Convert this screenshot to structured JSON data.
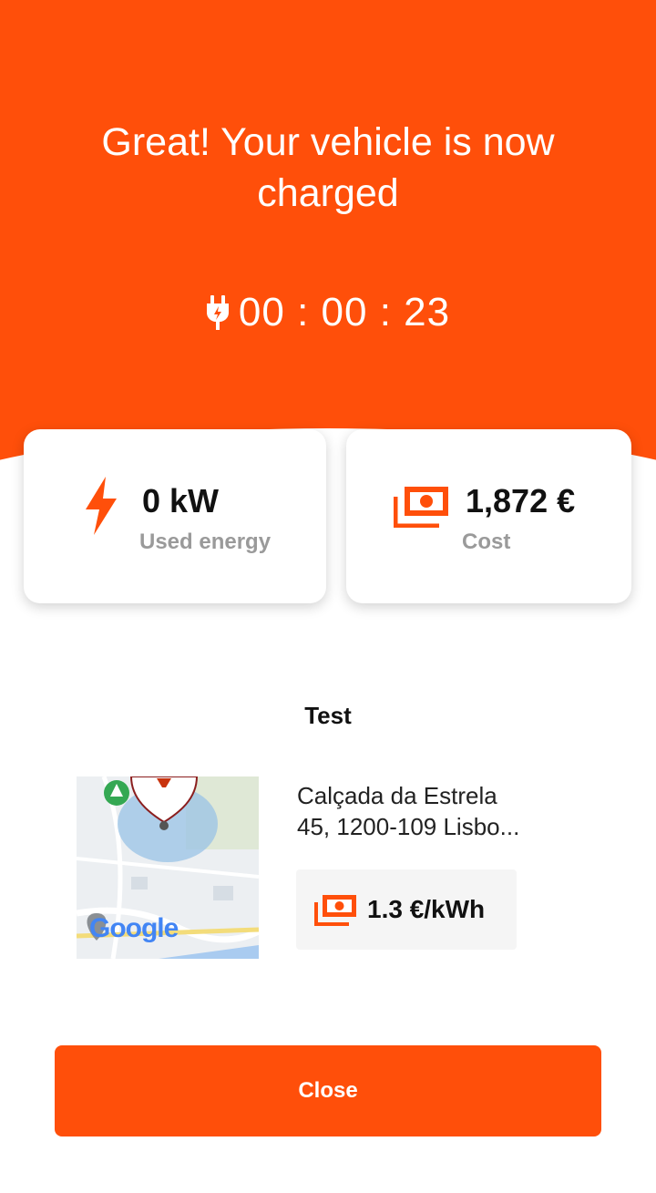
{
  "header": {
    "title": "Great! Your vehicle is now charged",
    "timer": "00 : 00 : 23",
    "timer_icon": "plug-icon"
  },
  "stats": {
    "energy": {
      "value": "0 kW",
      "label": "Used energy",
      "icon": "lightning-bolt-icon"
    },
    "cost": {
      "value": "1,872 €",
      "label": "Cost",
      "icon": "money-stack-icon"
    }
  },
  "station": {
    "name": "Test",
    "address_line1": "Calçada da Estrela",
    "address_line2": "45, 1200-109 Lisbo...",
    "price": "1.3 €/kWh",
    "price_icon": "money-stack-icon",
    "map_logo": "Google"
  },
  "actions": {
    "close_label": "Close"
  },
  "colors": {
    "accent": "#FF4F0A",
    "background": "#FFFFFF",
    "muted_text": "#9A9A9A"
  }
}
